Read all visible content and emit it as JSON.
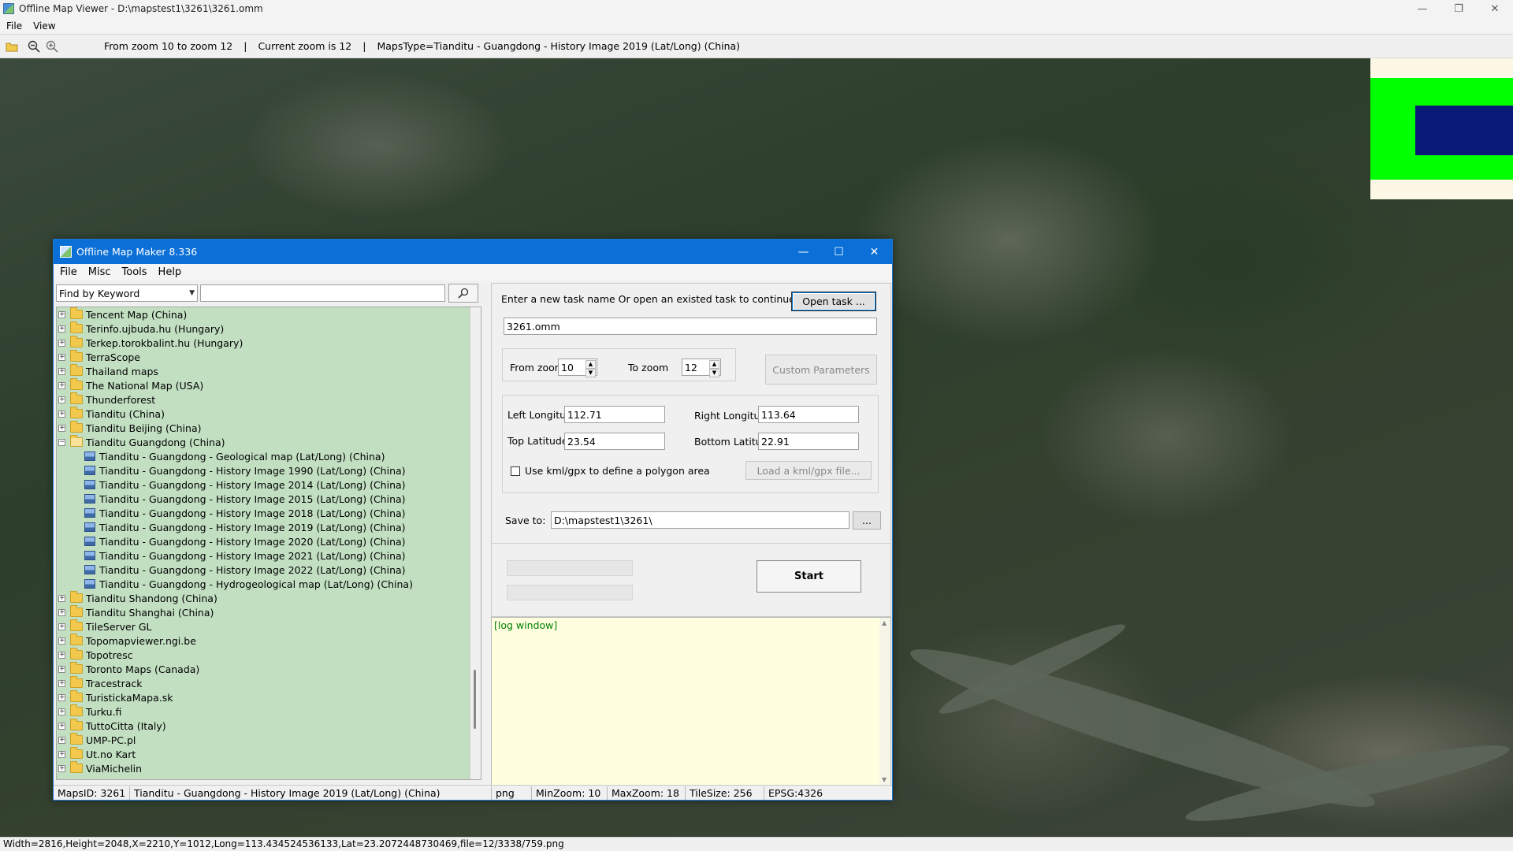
{
  "viewer": {
    "title": "Offline Map Viewer - D:\\mapstest1\\3261\\3261.omm",
    "menu": [
      "File",
      "View"
    ],
    "toolbar": {
      "zoom_range": "From zoom 10 to zoom 12",
      "current_zoom": "Current zoom is 12",
      "maps_type": "MapsType=Tianditu - Guangdong - History Image 2019 (Lat/Long) (China)",
      "sep": "|"
    },
    "status": "Width=2816,Height=2048,X=2210,Y=1012,Long=113.434524536133,Lat=23.2072448730469,file=12/3338/759.png",
    "colors": {
      "overview_bg": "#fdf8e6",
      "overview_extent": "#00ff00",
      "overview_view": "#0a1a78"
    }
  },
  "maker": {
    "title": "Offline Map Maker 8.336",
    "menu": [
      "File",
      "Misc",
      "Tools",
      "Help"
    ],
    "find": {
      "mode": "Find by Keyword",
      "value": ""
    },
    "tree": [
      {
        "label": "Tencent Map (China)",
        "type": "folder"
      },
      {
        "label": "Terinfo.ujbuda.hu (Hungary)",
        "type": "folder"
      },
      {
        "label": "Terkep.torokbalint.hu (Hungary)",
        "type": "folder"
      },
      {
        "label": "TerraScope",
        "type": "folder"
      },
      {
        "label": "Thailand maps",
        "type": "folder"
      },
      {
        "label": "The National Map (USA)",
        "type": "folder"
      },
      {
        "label": "Thunderforest",
        "type": "folder"
      },
      {
        "label": "Tianditu (China)",
        "type": "folder"
      },
      {
        "label": "Tianditu Beijing (China)",
        "type": "folder"
      },
      {
        "label": "Tianditu Guangdong (China)",
        "type": "folder-open"
      },
      {
        "label": "Tianditu - Guangdong - Geological map (Lat/Long) (China)",
        "type": "map"
      },
      {
        "label": "Tianditu - Guangdong - History Image 1990 (Lat/Long) (China)",
        "type": "map"
      },
      {
        "label": "Tianditu - Guangdong - History Image 2014 (Lat/Long) (China)",
        "type": "map"
      },
      {
        "label": "Tianditu - Guangdong - History Image 2015 (Lat/Long) (China)",
        "type": "map"
      },
      {
        "label": "Tianditu - Guangdong - History Image 2018 (Lat/Long) (China)",
        "type": "map"
      },
      {
        "label": "Tianditu - Guangdong - History Image 2019 (Lat/Long) (China)",
        "type": "map"
      },
      {
        "label": "Tianditu - Guangdong - History Image 2020 (Lat/Long) (China)",
        "type": "map"
      },
      {
        "label": "Tianditu - Guangdong - History Image 2021 (Lat/Long) (China)",
        "type": "map"
      },
      {
        "label": "Tianditu - Guangdong - History Image 2022 (Lat/Long) (China)",
        "type": "map"
      },
      {
        "label": "Tianditu - Guangdong - Hydrogeological map (Lat/Long) (China)",
        "type": "map"
      },
      {
        "label": "Tianditu Shandong (China)",
        "type": "folder"
      },
      {
        "label": "Tianditu Shanghai (China)",
        "type": "folder"
      },
      {
        "label": "TileServer GL",
        "type": "folder"
      },
      {
        "label": "Topomapviewer.ngi.be",
        "type": "folder"
      },
      {
        "label": "Topotresc",
        "type": "folder"
      },
      {
        "label": "Toronto Maps (Canada)",
        "type": "folder"
      },
      {
        "label": "Tracestrack",
        "type": "folder"
      },
      {
        "label": "TuristickaMapa.sk",
        "type": "folder"
      },
      {
        "label": "Turku.fi",
        "type": "folder"
      },
      {
        "label": "TuttoCitta (Italy)",
        "type": "folder"
      },
      {
        "label": "UMP-PC.pl",
        "type": "folder"
      },
      {
        "label": "Ut.no Kart",
        "type": "folder"
      },
      {
        "label": "ViaMichelin",
        "type": "folder"
      }
    ],
    "task": {
      "prompt": "Enter a new task name Or open an existed task to continue:",
      "open_button": "Open task ...",
      "name": "3261.omm"
    },
    "zoom": {
      "from_label": "From zoom",
      "from": "10",
      "to_label": "To zoom",
      "to": "12",
      "custom_button": "Custom Parameters"
    },
    "bounds": {
      "left_label": "Left Longitude",
      "left": "112.71",
      "right_label": "Right Longitude",
      "right": "113.64",
      "top_label": "Top Latitude",
      "top": "23.54",
      "bottom_label": "Bottom Latitude",
      "bottom": "22.91",
      "kml_label": "Use kml/gpx to define a polygon area",
      "kml_button": "Load a kml/gpx file..."
    },
    "save": {
      "label": "Save to:",
      "path": "D:\\mapstest1\\3261\\",
      "browse": "..."
    },
    "start_button": "Start",
    "log": "[log window]",
    "status": {
      "maps_id": "MapsID:  3261",
      "maps_name": "Tianditu - Guangdong - History Image 2019 (Lat/Long) (China)",
      "format": "png",
      "min_zoom": "MinZoom: 10",
      "max_zoom": "MaxZoom: 18",
      "tile_size": "TileSize: 256",
      "epsg": "EPSG:4326"
    }
  }
}
